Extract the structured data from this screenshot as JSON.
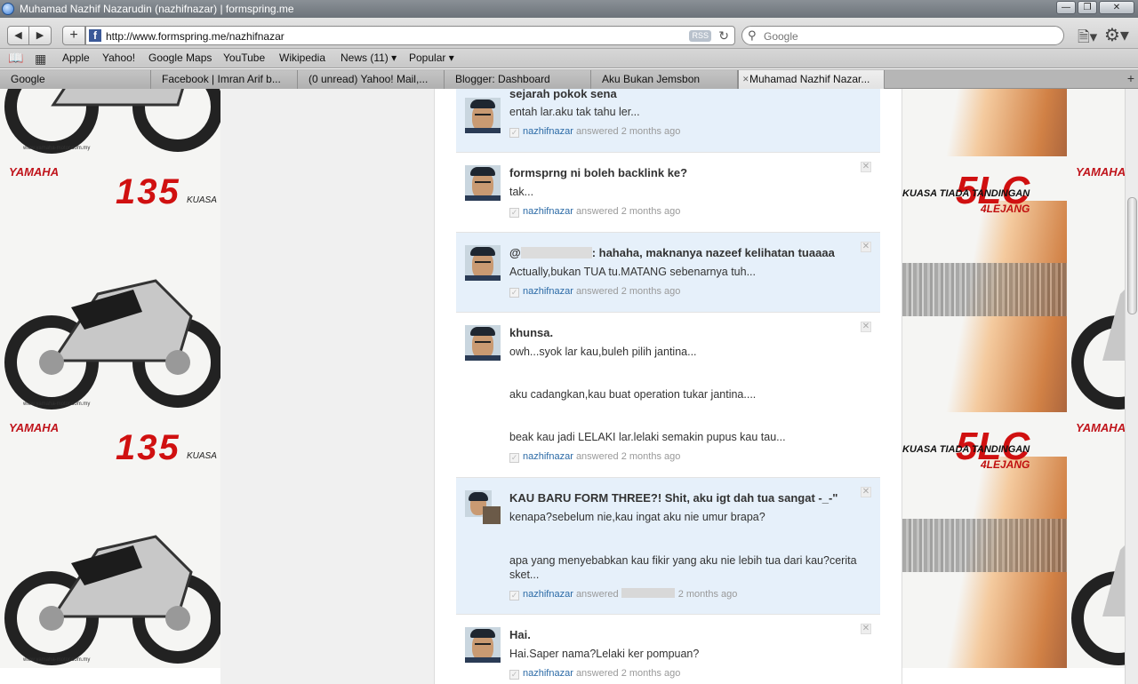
{
  "window": {
    "title": "Muhamad Nazhif Nazarudin (nazhifnazar) | formspring.me"
  },
  "toolbar": {
    "url": "http://www.formspring.me/nazhifnazar",
    "rss_label": "RSS",
    "search_placeholder": "Google"
  },
  "bookmarks": {
    "items": [
      "Apple",
      "Yahoo!",
      "Google Maps",
      "YouTube",
      "Wikipedia",
      "News (11) ▾",
      "Popular ▾"
    ]
  },
  "tabs": [
    "Google",
    "Facebook | Imran Arif b...",
    "(0 unread) Yahoo! Mail,...",
    "Blogger: Dashboard",
    "Aku Bukan Jemsbon",
    "Muhamad Nazhif Nazar..."
  ],
  "background_ad": {
    "brand": "YAMAHA",
    "model_left": "135",
    "tagline_left": "KUASA",
    "model_right": "5LC",
    "tagline_right": "KUASA TIADA TANDINGAN",
    "badge_right": "4LEJANG",
    "site": "www.yamaha-motor.com.my"
  },
  "qa_items": [
    {
      "question": "sejarah pokok sena",
      "answer_lines": [
        "entah lar.aku tak tahu ler..."
      ],
      "user": "nazhifnazar",
      "answered": "answered",
      "time": "2 months ago"
    },
    {
      "question": "formsprng ni boleh backlink ke?",
      "answer_lines": [
        "tak..."
      ],
      "user": "nazhifnazar",
      "answered": "answered",
      "time": "2 months ago"
    },
    {
      "question_prefix": "@",
      "question": ": hahaha, maknanya nazeef kelihatan tuaaaa",
      "answer_lines": [
        "Actually,bukan TUA tu.MATANG sebenarnya tuh..."
      ],
      "user": "nazhifnazar",
      "answered": "answered",
      "time": "2 months ago"
    },
    {
      "question": "khunsa.",
      "answer_lines": [
        "owh...syok lar kau,buleh pilih jantina...",
        "aku cadangkan,kau buat operation tukar jantina....",
        "beak kau jadi LELAKI lar.lelaki semakin pupus kau tau..."
      ],
      "user": "nazhifnazar",
      "answered": "answered",
      "time": "2 months ago"
    },
    {
      "question": "KAU BARU FORM THREE?! Shit, aku igt dah tua sangat -_-\"",
      "answer_lines": [
        "kenapa?sebelum nie,kau ingat aku nie umur brapa?",
        "apa yang menyebabkan kau fikir yang aku nie lebih tua dari kau?cerita sket..."
      ],
      "user": "nazhifnazar",
      "answered": "answered",
      "time": "2 months ago"
    },
    {
      "question": "Hai.",
      "answer_lines": [
        "Hai.Saper nama?Lelaki ker pompuan?"
      ],
      "user": "nazhifnazar",
      "answered": "answered",
      "time": "2 months ago"
    }
  ]
}
